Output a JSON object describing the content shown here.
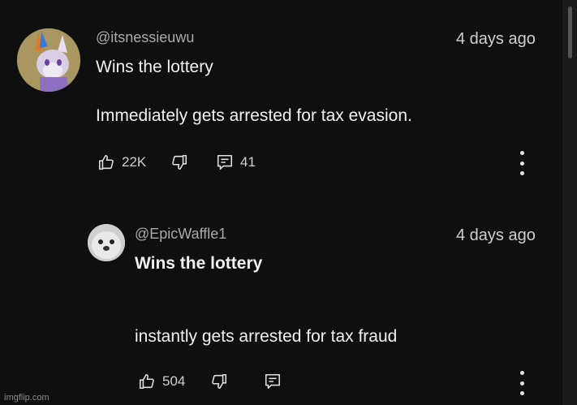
{
  "comments": [
    {
      "handle": "@itsnessieuwu",
      "time": "4 days ago",
      "line1": "Wins the lottery",
      "line2": "Immediately gets arrested for tax evasion.",
      "likes": "22K",
      "replies": "41"
    },
    {
      "handle": "@EpicWaffle1",
      "time": "4 days ago",
      "line1": "Wins the lottery",
      "line2": "instantly gets arrested for tax fraud",
      "likes": "504"
    }
  ],
  "watermark": "imgflip.com",
  "icons": {
    "like": "thumbs-up-icon",
    "dislike": "thumbs-down-icon",
    "reply": "reply-icon",
    "more": "more-vert-icon"
  },
  "colors": {
    "background": "#0f0f0f",
    "primary_text": "#f1f1f1",
    "secondary_text": "#aaaaaa"
  }
}
